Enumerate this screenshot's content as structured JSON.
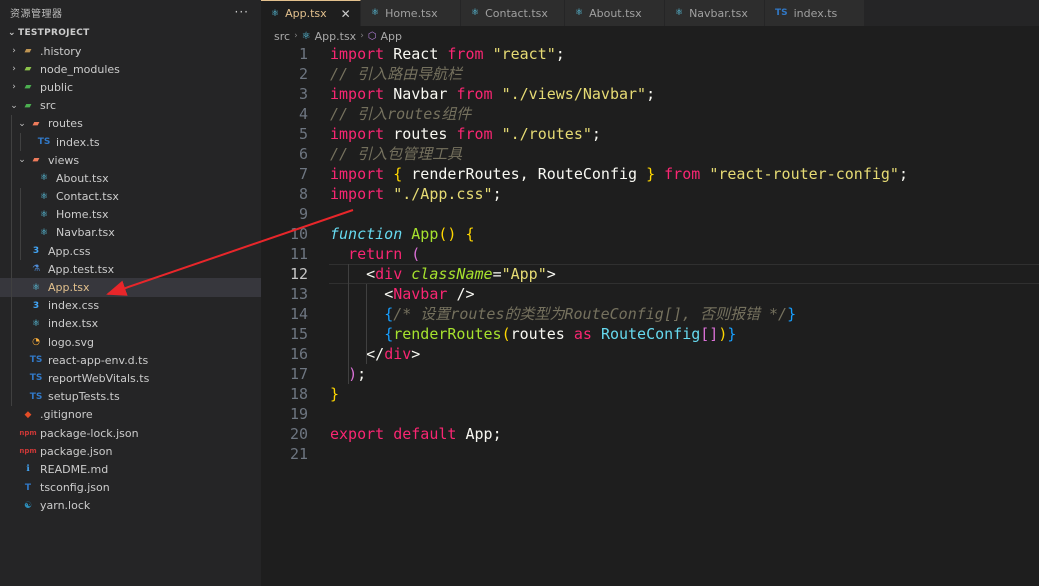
{
  "sidebar": {
    "title": "资源管理器",
    "more": "···",
    "project": "TESTPROJECT",
    "items": [
      {
        "label": ".history",
        "icon": "folder-icon",
        "kind": "folder",
        "depth": 0
      },
      {
        "label": "node_modules",
        "icon": "node-folder-icon",
        "kind": "folder",
        "depth": 0
      },
      {
        "label": "public",
        "icon": "public-folder-icon",
        "kind": "folder",
        "depth": 0
      },
      {
        "label": "src",
        "icon": "src-folder-icon",
        "kind": "folder-open",
        "depth": 0
      },
      {
        "label": "routes",
        "icon": "routes-folder-icon",
        "kind": "folder-open",
        "depth": 1
      },
      {
        "label": "index.ts",
        "icon": "typescript-icon",
        "kind": "file",
        "depth": 2
      },
      {
        "label": "views",
        "icon": "views-folder-icon",
        "kind": "folder-open",
        "depth": 1
      },
      {
        "label": "About.tsx",
        "icon": "react-icon",
        "kind": "file",
        "depth": 2
      },
      {
        "label": "Contact.tsx",
        "icon": "react-icon",
        "kind": "file",
        "depth": 2
      },
      {
        "label": "Home.tsx",
        "icon": "react-icon",
        "kind": "file",
        "depth": 2
      },
      {
        "label": "Navbar.tsx",
        "icon": "react-icon",
        "kind": "file",
        "depth": 2
      },
      {
        "label": "App.css",
        "icon": "css-icon",
        "kind": "file",
        "depth": 1
      },
      {
        "label": "App.test.tsx",
        "icon": "test-icon",
        "kind": "file",
        "depth": 1
      },
      {
        "label": "App.tsx",
        "icon": "react-icon",
        "kind": "file",
        "depth": 1,
        "active": true
      },
      {
        "label": "index.css",
        "icon": "css-icon",
        "kind": "file",
        "depth": 1
      },
      {
        "label": "index.tsx",
        "icon": "react-icon",
        "kind": "file",
        "depth": 1
      },
      {
        "label": "logo.svg",
        "icon": "svg-icon",
        "kind": "file",
        "depth": 1
      },
      {
        "label": "react-app-env.d.ts",
        "icon": "typescript-icon",
        "kind": "file",
        "depth": 1
      },
      {
        "label": "reportWebVitals.ts",
        "icon": "typescript-icon",
        "kind": "file",
        "depth": 1
      },
      {
        "label": "setupTests.ts",
        "icon": "typescript-icon",
        "kind": "file",
        "depth": 1
      },
      {
        "label": ".gitignore",
        "icon": "git-icon",
        "kind": "file",
        "depth": 0
      },
      {
        "label": "package-lock.json",
        "icon": "npm-icon",
        "kind": "file",
        "depth": 0
      },
      {
        "label": "package.json",
        "icon": "npm-icon",
        "kind": "file",
        "depth": 0
      },
      {
        "label": "README.md",
        "icon": "readme-icon",
        "kind": "file",
        "depth": 0
      },
      {
        "label": "tsconfig.json",
        "icon": "tsconfig-icon",
        "kind": "file",
        "depth": 0
      },
      {
        "label": "yarn.lock",
        "icon": "yarn-icon",
        "kind": "file",
        "depth": 0
      }
    ]
  },
  "tabs": [
    {
      "label": "App.tsx",
      "icon": "react-icon",
      "active": true,
      "close": "✕"
    },
    {
      "label": "Home.tsx",
      "icon": "react-icon"
    },
    {
      "label": "Contact.tsx",
      "icon": "react-icon"
    },
    {
      "label": "About.tsx",
      "icon": "react-icon"
    },
    {
      "label": "Navbar.tsx",
      "icon": "react-icon"
    },
    {
      "label": "index.ts",
      "icon": "typescript-icon"
    }
  ],
  "breadcrumb": {
    "folder": "src",
    "file": "App.tsx",
    "symbol": "App"
  },
  "current_line": 12,
  "code": [
    {
      "n": "1",
      "t": [
        [
          "kw",
          "import "
        ],
        [
          "def",
          "React "
        ],
        [
          "kw",
          "from "
        ],
        [
          "str",
          "\"react\""
        ],
        [
          "pun",
          ";"
        ]
      ]
    },
    {
      "n": "2",
      "t": [
        [
          "cm",
          "// 引入路由导航栏"
        ]
      ]
    },
    {
      "n": "3",
      "t": [
        [
          "kw",
          "import "
        ],
        [
          "def",
          "Navbar "
        ],
        [
          "kw",
          "from "
        ],
        [
          "str",
          "\"./views/Navbar\""
        ],
        [
          "pun",
          ";"
        ]
      ]
    },
    {
      "n": "4",
      "t": [
        [
          "cm",
          "// 引入routes组件"
        ]
      ]
    },
    {
      "n": "5",
      "t": [
        [
          "kw",
          "import "
        ],
        [
          "def",
          "routes "
        ],
        [
          "kw",
          "from "
        ],
        [
          "str",
          "\"./routes\""
        ],
        [
          "pun",
          ";"
        ]
      ]
    },
    {
      "n": "6",
      "t": [
        [
          "cm",
          "// 引入包管理工具"
        ]
      ]
    },
    {
      "n": "7",
      "t": [
        [
          "kw",
          "import "
        ],
        [
          "brc1",
          "{ "
        ],
        [
          "def",
          "renderRoutes, RouteConfig "
        ],
        [
          "brc1",
          "} "
        ],
        [
          "kw",
          "from "
        ],
        [
          "str",
          "\"react-router-config\""
        ],
        [
          "pun",
          ";"
        ]
      ]
    },
    {
      "n": "8",
      "t": [
        [
          "kw",
          "import "
        ],
        [
          "str",
          "\"./App.css\""
        ],
        [
          "pun",
          ";"
        ]
      ]
    },
    {
      "n": "9",
      "t": []
    },
    {
      "n": "10",
      "t": [
        [
          "ty itl",
          "function "
        ],
        [
          "fn",
          "App"
        ],
        [
          "brc1",
          "() {"
        ]
      ]
    },
    {
      "n": "11",
      "t": [
        [
          "def",
          "  "
        ],
        [
          "kw",
          "return "
        ],
        [
          "brc2",
          "("
        ]
      ]
    },
    {
      "n": "12",
      "t": [
        [
          "def",
          "    "
        ],
        [
          "ang",
          "<"
        ],
        [
          "tag",
          "div "
        ],
        [
          "attr",
          "className"
        ],
        [
          "pun",
          "="
        ],
        [
          "str",
          "\"App\""
        ],
        [
          "ang",
          ">"
        ]
      ]
    },
    {
      "n": "13",
      "t": [
        [
          "def",
          "      "
        ],
        [
          "ang",
          "<"
        ],
        [
          "tag",
          "Navbar "
        ],
        [
          "ang",
          "/>"
        ]
      ]
    },
    {
      "n": "14",
      "t": [
        [
          "def",
          "      "
        ],
        [
          "brc3",
          "{"
        ],
        [
          "cm",
          "/* 设置routes的类型为RouteConfig[], 否则报错 */"
        ],
        [
          "brc3",
          "}"
        ]
      ]
    },
    {
      "n": "15",
      "t": [
        [
          "def",
          "      "
        ],
        [
          "brc3",
          "{"
        ],
        [
          "fn",
          "renderRoutes"
        ],
        [
          "brc1",
          "("
        ],
        [
          "def",
          "routes "
        ],
        [
          "kw",
          "as "
        ],
        [
          "ty",
          "RouteConfig"
        ],
        [
          "brc2",
          "[]"
        ],
        [
          "brc1",
          ")"
        ],
        [
          "brc3",
          "}"
        ]
      ]
    },
    {
      "n": "16",
      "t": [
        [
          "def",
          "    "
        ],
        [
          "ang",
          "</"
        ],
        [
          "tag",
          "div"
        ],
        [
          "ang",
          ">"
        ]
      ]
    },
    {
      "n": "17",
      "t": [
        [
          "def",
          "  "
        ],
        [
          "brc2",
          ")"
        ],
        [
          "pun",
          ";"
        ]
      ]
    },
    {
      "n": "18",
      "t": [
        [
          "brc1",
          "}"
        ]
      ]
    },
    {
      "n": "19",
      "t": []
    },
    {
      "n": "20",
      "t": [
        [
          "kw",
          "export default "
        ],
        [
          "def",
          "App"
        ],
        [
          "pun",
          ";"
        ]
      ]
    },
    {
      "n": "21",
      "t": []
    }
  ],
  "colors": {
    "annotation_arrow": "#e8262a",
    "active_tab": "#e2c08d"
  }
}
